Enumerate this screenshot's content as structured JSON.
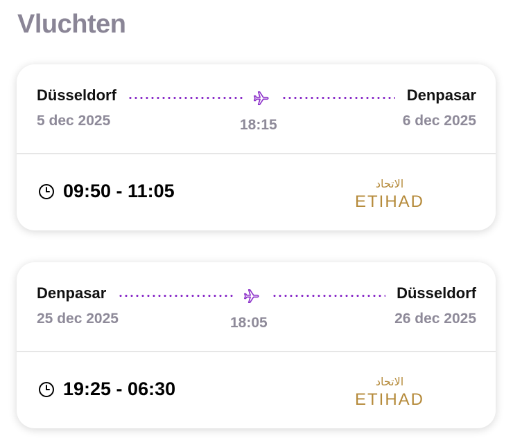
{
  "page": {
    "title": "Vluchten"
  },
  "flights": [
    {
      "from_city": "Düsseldorf",
      "from_date": "5 dec 2025",
      "to_city": "Denpasar",
      "to_date": "6 dec 2025",
      "duration": "18:15",
      "times": "09:50 - 11:05",
      "airline": "ETIHAD",
      "airline_arabic": "الاتحاد",
      "icon_plane": "plane-icon",
      "icon_clock": "clock-icon"
    },
    {
      "from_city": "Denpasar",
      "from_date": "25 dec 2025",
      "to_city": "Düsseldorf",
      "to_date": "26 dec 2025",
      "duration": "18:05",
      "times": "19:25 - 06:30",
      "airline": "ETIHAD",
      "airline_arabic": "الاتحاد",
      "icon_plane": "plane-icon",
      "icon_clock": "clock-icon"
    }
  ],
  "colors": {
    "accent": "#8b2fc9",
    "muted": "#8e8a99",
    "title": "#8a8596",
    "airline_gold": "#b58a3a"
  }
}
